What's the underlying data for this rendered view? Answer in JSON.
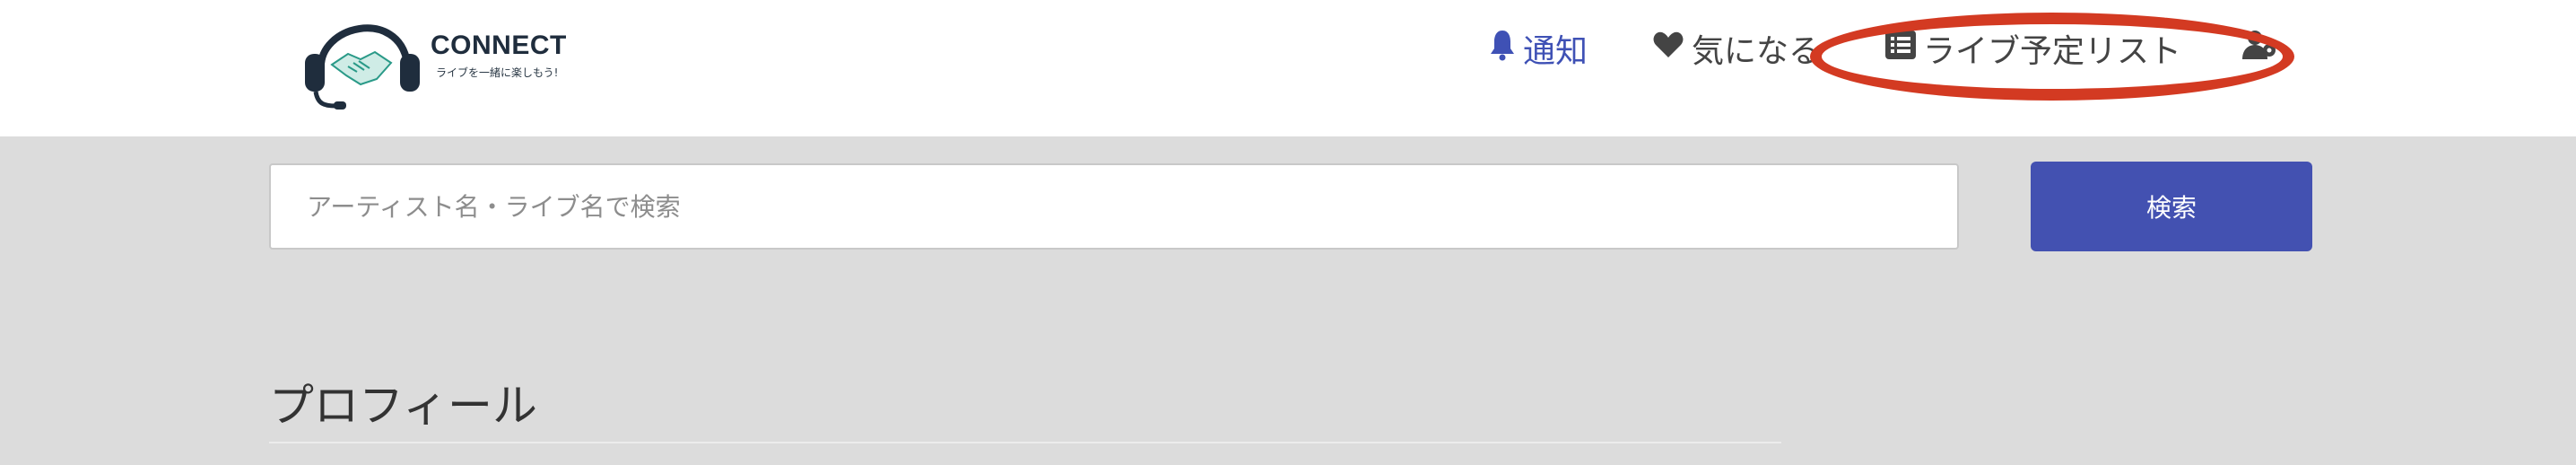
{
  "logo": {
    "name": "CONNECT",
    "tagline": "ライブを一緒に楽しもう!"
  },
  "nav": {
    "notify": "通知",
    "favorites": "気になる",
    "schedule_list": "ライブ予定リスト"
  },
  "search": {
    "placeholder": "アーティスト名・ライブ名で検索",
    "button": "検索"
  },
  "section": {
    "title": "プロフィール"
  },
  "colors": {
    "accent": "#4351b1",
    "highlight_ellipse": "#d33a22",
    "background": "#dcdcdc"
  },
  "icons": [
    "headset-handshake-logo",
    "bell-icon",
    "heart-icon",
    "list-icon",
    "user-gear-icon"
  ]
}
